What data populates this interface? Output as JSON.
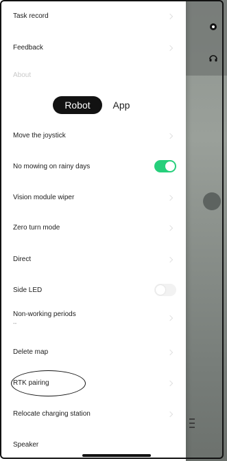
{
  "menu": {
    "task_record": "Task record",
    "feedback": "Feedback",
    "about": "About"
  },
  "tabs": {
    "robot": "Robot",
    "app": "App"
  },
  "settings": {
    "move_joystick": "Move the joystick",
    "no_mowing_rain": "No mowing on rainy days",
    "no_mowing_rain_enabled": true,
    "vision_wiper": "Vision module wiper",
    "zero_turn": "Zero turn mode",
    "direct": "Direct",
    "side_led": "Side LED",
    "side_led_enabled": false,
    "non_working": "Non-working periods",
    "non_working_value": "--",
    "delete_map": "Delete map",
    "rtk_pairing": "RTK pairing",
    "relocate_station": "Relocate charging station",
    "speaker": "Speaker"
  },
  "colors": {
    "toggle_on": "#26cf7b",
    "segment_active": "#121212"
  },
  "icons": {
    "settings": "gear-icon",
    "support": "headset-icon"
  }
}
